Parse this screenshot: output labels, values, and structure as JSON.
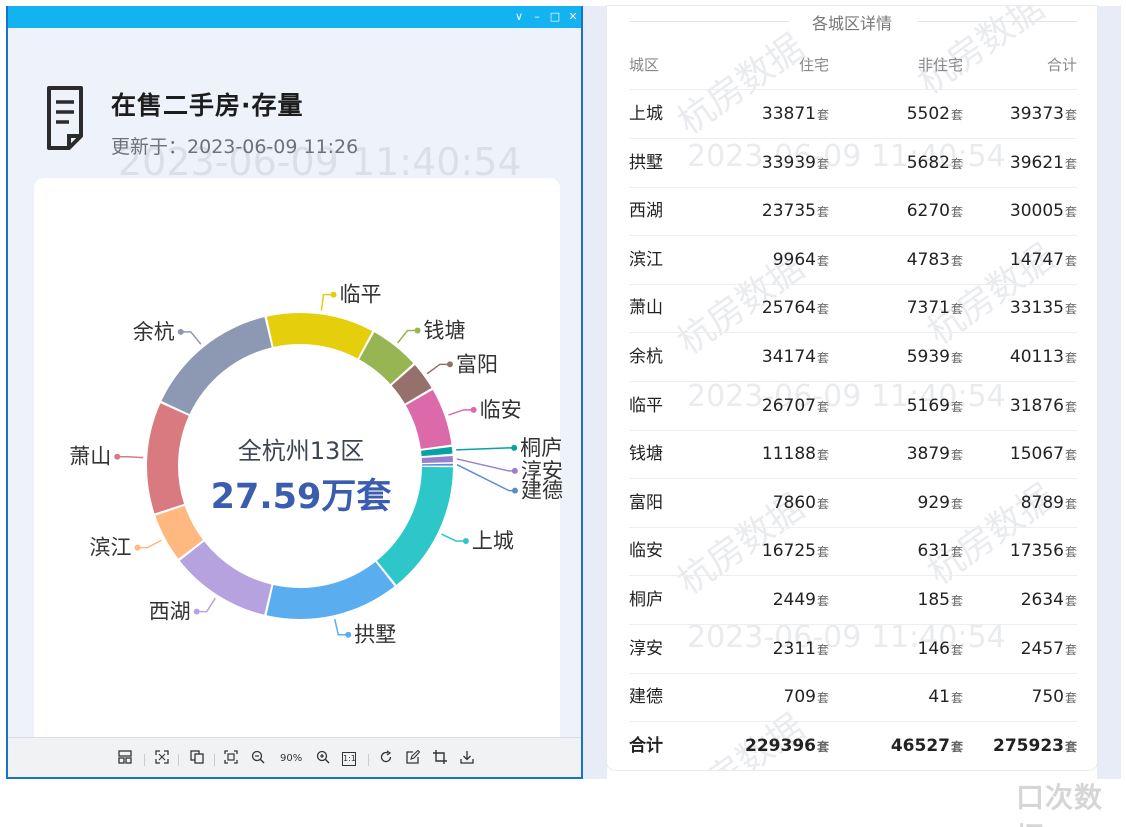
{
  "window": {
    "controls": [
      "∨",
      "–",
      "□",
      "✕"
    ]
  },
  "header": {
    "title": "在售二手房·存量",
    "update_label": "更新于：",
    "update_time": "2023-06-09 11:26",
    "watermark_time": "2023-06-09 11:40:54"
  },
  "watermarks": {
    "brand": "杭房数据",
    "time": "2023-06-09 11:40:54"
  },
  "chart_data": {
    "type": "pie",
    "variant": "donut",
    "center_line1": "全杭州13区",
    "center_line2": "27.59万套",
    "slices": [
      {
        "label": "上城",
        "value": 39373,
        "color": "#2ec7c9"
      },
      {
        "label": "拱墅",
        "value": 39621,
        "color": "#5aaef0"
      },
      {
        "label": "西湖",
        "value": 30005,
        "color": "#b6a2de"
      },
      {
        "label": "滨江",
        "value": 14747,
        "color": "#ffb980"
      },
      {
        "label": "萧山",
        "value": 33135,
        "color": "#d87a80"
      },
      {
        "label": "余杭",
        "value": 40113,
        "color": "#8d98b3"
      },
      {
        "label": "临平",
        "value": 31876,
        "color": "#e5cf0d"
      },
      {
        "label": "钱塘",
        "value": 15067,
        "color": "#97b552"
      },
      {
        "label": "富阳",
        "value": 8789,
        "color": "#95706d"
      },
      {
        "label": "临安",
        "value": 17356,
        "color": "#dc69aa"
      },
      {
        "label": "桐庐",
        "value": 2634,
        "color": "#07a2a4"
      },
      {
        "label": "淳安",
        "value": 2457,
        "color": "#9a7fd1"
      },
      {
        "label": "建德",
        "value": 750,
        "color": "#588dd5"
      }
    ]
  },
  "toolbar": {
    "zoom": "90%",
    "one_to_one": "1:1"
  },
  "table": {
    "title": "各城区详情",
    "unit": "套",
    "headers": [
      "城区",
      "住宅",
      "非住宅",
      "合计"
    ],
    "rows": [
      {
        "name": "上城",
        "res": "33871",
        "nonres": "5502",
        "total": "39373"
      },
      {
        "name": "拱墅",
        "res": "33939",
        "nonres": "5682",
        "total": "39621"
      },
      {
        "name": "西湖",
        "res": "23735",
        "nonres": "6270",
        "total": "30005"
      },
      {
        "name": "滨江",
        "res": "9964",
        "nonres": "4783",
        "total": "14747"
      },
      {
        "name": "萧山",
        "res": "25764",
        "nonres": "7371",
        "total": "33135"
      },
      {
        "name": "余杭",
        "res": "34174",
        "nonres": "5939",
        "total": "40113"
      },
      {
        "name": "临平",
        "res": "26707",
        "nonres": "5169",
        "total": "31876"
      },
      {
        "name": "钱塘",
        "res": "11188",
        "nonres": "3879",
        "total": "15067"
      },
      {
        "name": "富阳",
        "res": "7860",
        "nonres": "929",
        "total": "8789"
      },
      {
        "name": "临安",
        "res": "16725",
        "nonres": "631",
        "total": "17356"
      },
      {
        "name": "桐庐",
        "res": "2449",
        "nonres": "185",
        "total": "2634"
      },
      {
        "name": "淳安",
        "res": "2311",
        "nonres": "146",
        "total": "2457"
      },
      {
        "name": "建德",
        "res": "709",
        "nonres": "41",
        "total": "750"
      }
    ],
    "total_row": {
      "name": "合计",
      "res": "229396",
      "nonres": "46527",
      "total": "275923"
    }
  },
  "corner_logo": "口次数据"
}
